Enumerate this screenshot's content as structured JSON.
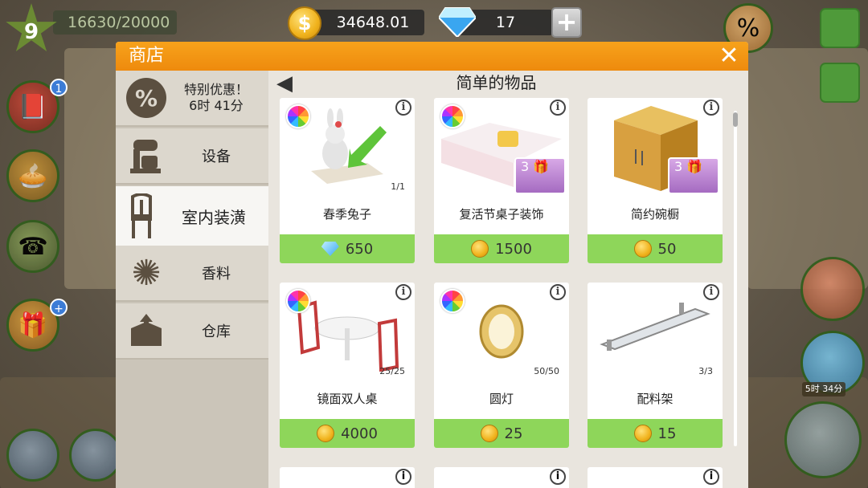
{
  "hud": {
    "level": "9",
    "xp": "16630/20000",
    "coins": "34648.01",
    "gems": "17",
    "plus_label": "+"
  },
  "right_panel": {
    "timer": "5时 34分"
  },
  "shop": {
    "title": "商店",
    "close_label": "✕",
    "section_title": "简单的物品",
    "categories": [
      {
        "label": "特别优惠！\n6时 41分",
        "icon": "percent-icon"
      },
      {
        "label": "设备",
        "icon": "mixer-icon"
      },
      {
        "label": "室内装潢",
        "icon": "chair-icon",
        "active": true
      },
      {
        "label": "香料",
        "icon": "star-anise-icon"
      },
      {
        "label": "仓库",
        "icon": "box-icon"
      }
    ],
    "special_offer_line1": "特别优惠！",
    "special_offer_line2": "6时 41分",
    "items": [
      {
        "name": "春季兔子",
        "price": "650",
        "currency": "gem",
        "count": "1/1"
      },
      {
        "name": "复活节桌子装饰",
        "price": "1500",
        "currency": "coin",
        "gift": "3"
      },
      {
        "name": "简约碗橱",
        "price": "50",
        "currency": "coin",
        "gift": "3"
      },
      {
        "name": "镜面双人桌",
        "price": "4000",
        "currency": "coin",
        "count": "25/25"
      },
      {
        "name": "圆灯",
        "price": "25",
        "currency": "coin",
        "count": "50/50"
      },
      {
        "name": "配料架",
        "price": "15",
        "currency": "coin",
        "count": "3/3"
      }
    ],
    "info_label": "i"
  },
  "colors": {
    "header_orange": "#ee8a0d",
    "price_green": "#8ed65a",
    "sidebar_bg": "#cbc5b9"
  }
}
